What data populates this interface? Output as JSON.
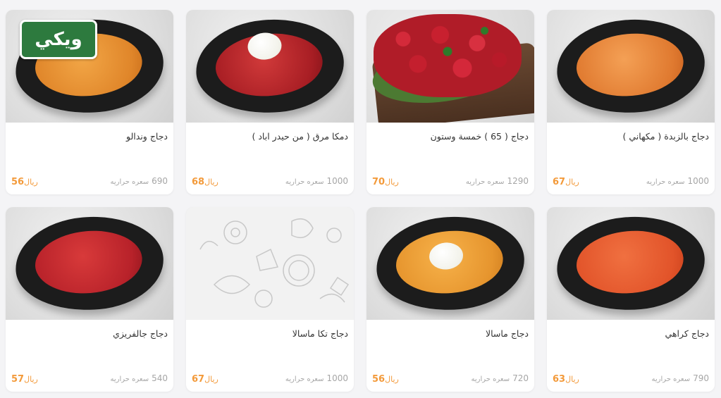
{
  "brand": {
    "logo_text": "ويكي",
    "color": "#2d7a3e"
  },
  "currency": "ريال",
  "cal_unit": "سعره حراريه",
  "accent_color": "#f39a3a",
  "items": [
    {
      "name": "دجاج بالزبدة ( مكهاني )",
      "price": "67",
      "calories": "1000",
      "image": "butter-chicken-bowl"
    },
    {
      "name": "دجاج ( 65 ) خمسة وستون",
      "price": "70",
      "calories": "1290",
      "image": "fried-chicken-on-board"
    },
    {
      "name": "دمكا مرق ( من حيدر اباد )",
      "price": "68",
      "calories": "1000",
      "image": "red-curry-egg-bowl"
    },
    {
      "name": "دجاج وندالو",
      "price": "56",
      "calories": "690",
      "image": "vindaloo-bowl"
    },
    {
      "name": "دجاج كراهي",
      "price": "63",
      "calories": "790",
      "image": "karahi-bowl"
    },
    {
      "name": "دجاج ماسالا",
      "price": "56",
      "calories": "720",
      "image": "masala-egg-bowl"
    },
    {
      "name": "دجاج تكا ماسالا",
      "price": "67",
      "calories": "1000",
      "image": "placeholder-pattern"
    },
    {
      "name": "دجاج جالفريزي",
      "price": "57",
      "calories": "540",
      "image": "jalfrezi-bowl"
    }
  ]
}
